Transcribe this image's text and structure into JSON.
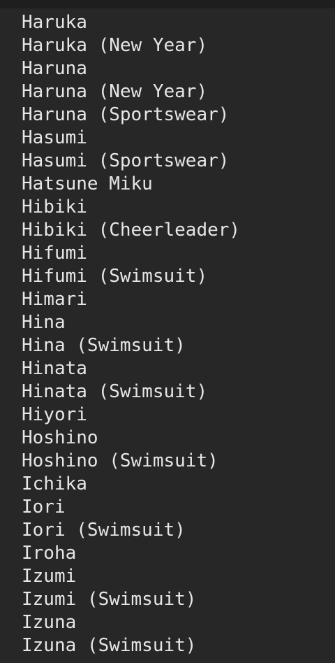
{
  "list": {
    "items": [
      "Haruka",
      "Haruka (New Year)",
      "Haruna",
      "Haruna (New Year)",
      "Haruna (Sportswear)",
      "Hasumi",
      "Hasumi (Sportswear)",
      "Hatsune Miku",
      "Hibiki",
      "Hibiki (Cheerleader)",
      "Hifumi",
      "Hifumi (Swimsuit)",
      "Himari",
      "Hina",
      "Hina (Swimsuit)",
      "Hinata",
      "Hinata (Swimsuit)",
      "Hiyori",
      "Hoshino",
      "Hoshino (Swimsuit)",
      "Ichika",
      "Iori",
      "Iori (Swimsuit)",
      "Iroha",
      "Izumi",
      "Izumi (Swimsuit)",
      "Izuna",
      "Izuna (Swimsuit)"
    ]
  },
  "colors": {
    "background": "#272727",
    "text": "#e6e6e6"
  }
}
